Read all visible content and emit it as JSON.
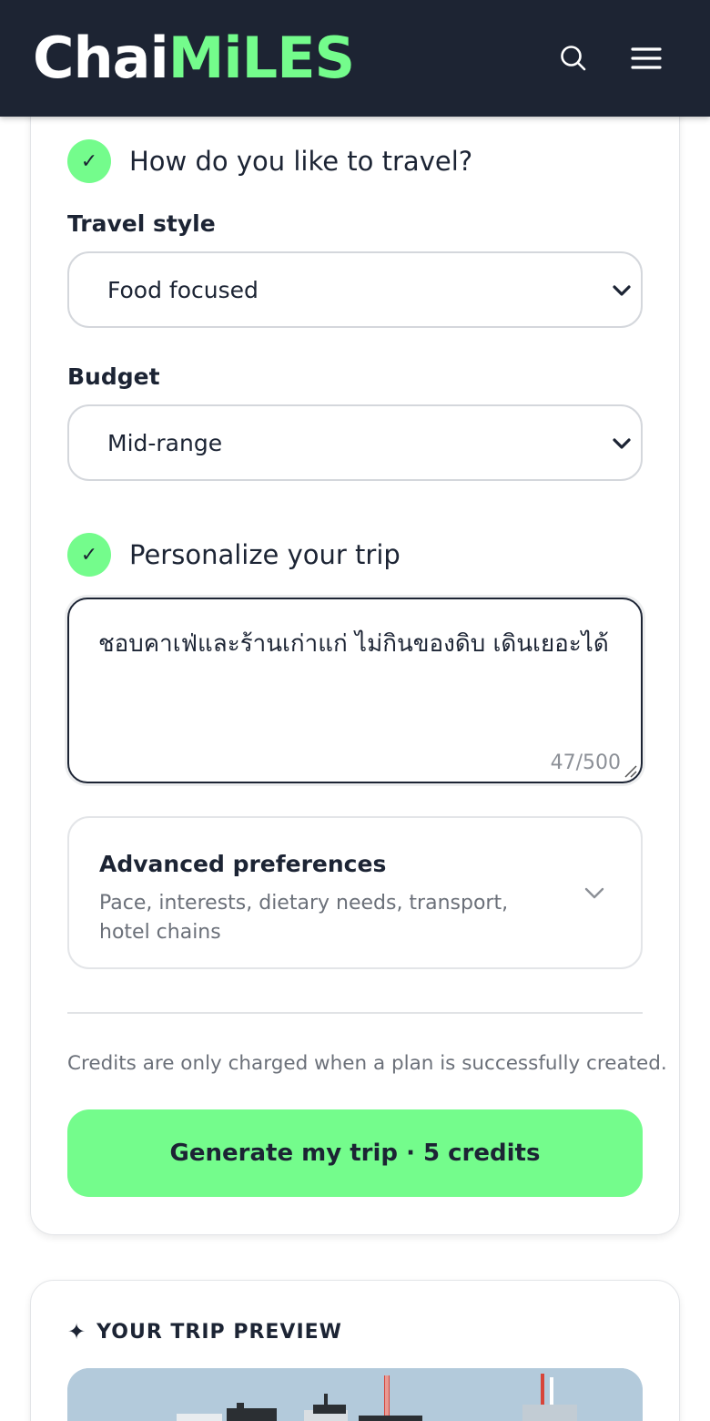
{
  "header": {
    "logo_part1": "Chai",
    "logo_part2": "MiLES",
    "colors": {
      "bar": "#1d2433",
      "accent": "#74fc8c"
    },
    "icons": [
      "search-icon",
      "menu-icon"
    ]
  },
  "travel": {
    "title": "How do you like to travel?",
    "style_label": "Travel style",
    "style_value": "Food focused",
    "budget_label": "Budget",
    "budget_value": "Mid-range"
  },
  "personalize": {
    "title": "Personalize your trip",
    "text": "ชอบคาเฟ่และร้านเก่าแก่ ไม่กินของดิบ เดินเยอะได้",
    "counter": "47/500"
  },
  "advanced": {
    "title": "Advanced preferences",
    "subtitle": "Pace, interests, dietary needs, transport, hotel chains"
  },
  "note": "Credits are only charged when a plan is successfully created.",
  "generate_label": "Generate my trip · 5 credits",
  "preview": {
    "title": "YOUR TRIP PREVIEW"
  }
}
